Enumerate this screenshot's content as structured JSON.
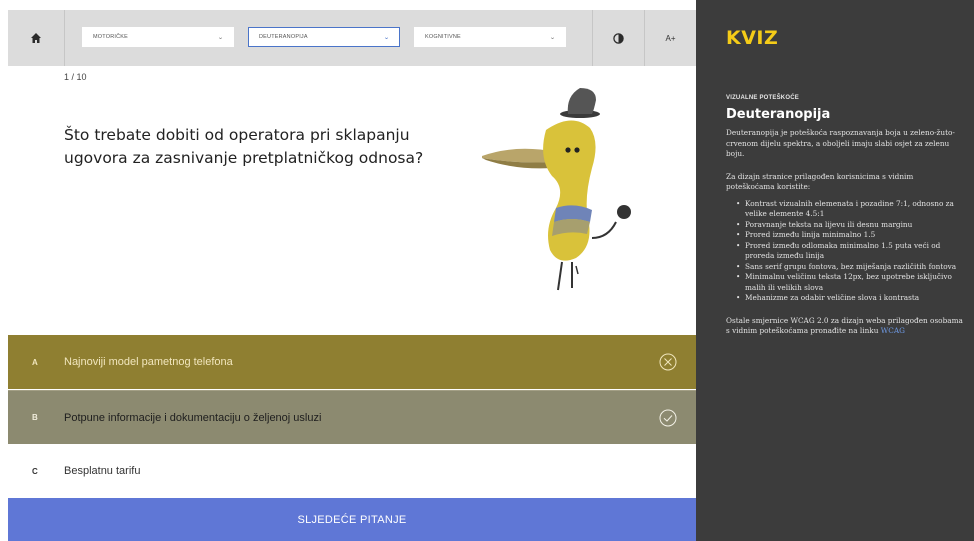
{
  "toolbar": {
    "selects": [
      {
        "label": "MOTORIČKE",
        "icon": "chevron-down-icon"
      },
      {
        "label": "DEUTERANOPIJA",
        "icon": "chevron-down-icon"
      },
      {
        "label": "KOGNITIVNE",
        "icon": "chevron-down-icon"
      }
    ],
    "home_icon": "home-icon",
    "contrast_icon": "contrast-icon",
    "font_size_label": "A+"
  },
  "quiz": {
    "counter": "1 / 10",
    "question": "Što trebate dobiti od operatora pri sklapanju ugovora za zasnivanje pretplatničkog odnosa?",
    "answers": [
      {
        "letter": "A",
        "text": "Najnoviji model pametnog telefona",
        "status_icon": "wrong-circle-x-icon"
      },
      {
        "letter": "B",
        "text": "Potpune informacije i dokumentaciju o željenoj usluzi",
        "status_icon": "correct-circle-check-icon"
      },
      {
        "letter": "C",
        "text": "Besplatnu tarifu"
      }
    ],
    "next_label": "SLJEDEĆE PITANJE"
  },
  "panel": {
    "logo": "KVIZ",
    "kicker": "VIZUALNE POTEŠKOĆE",
    "title": "Deuteranopija",
    "intro": "Deuteranopija je poteškoća raspoznavanja boja u zeleno-žuto-crvenom dijelu spektra, a oboljeli imaju slabi osjet za zelenu boju.",
    "intro2": "Za dizajn stranice prilagođen korisnicima s vidnim poteškoćama koristite:",
    "bullets": [
      "Kontrast vizualnih elemenata i pozadine 7:1, odnosno za velike elemente 4.5:1",
      "Poravnanje teksta na lijevu ili desnu marginu",
      "Prored između linija minimalno 1.5",
      "Prored između odlomaka minimalno 1.5 puta veći od proreda između linija",
      "Sans serif grupu fontova, bez miješanja različitih fontova",
      "Minimalnu veličinu teksta 12px, bez upotrebe isključivo malih ili velikih slova",
      "Mehanizme za odabir veličine slova i kontrasta"
    ],
    "outro": "Ostale smjernice WCAG 2.0 za dizajn weba prilagođen osobama s vidnim poteškoćama pronađite na linku",
    "link": "WCAG"
  },
  "colors": {
    "accent_yellow": "#f5cc18",
    "answer_wrong": "#8f7f31",
    "answer_correct": "#8c8a70",
    "next_button": "#5f77d6",
    "panel_bg": "#3c3c3c"
  }
}
